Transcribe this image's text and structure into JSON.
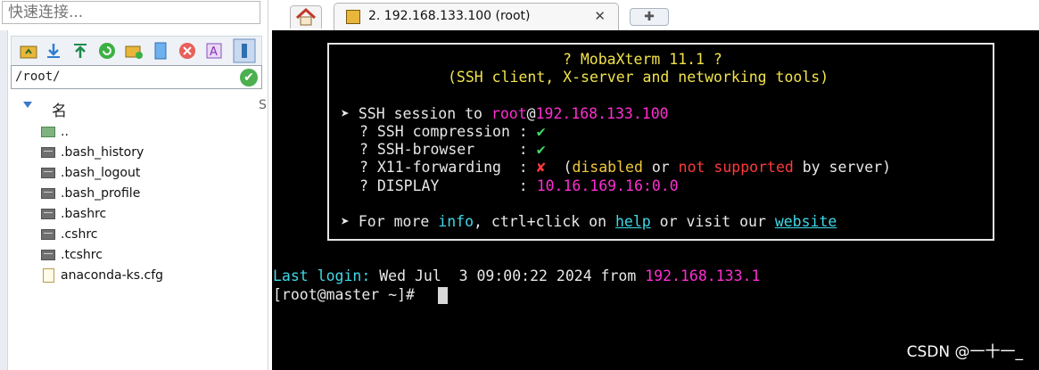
{
  "quick_connect": {
    "placeholder": "快速连接..."
  },
  "path": {
    "value": "/root/"
  },
  "file_list": {
    "header_name": "名",
    "header_sep": "S",
    "items": [
      {
        "name": "..",
        "icon": "folder-up-icon"
      },
      {
        "name": ".bash_history",
        "icon": "file-icon"
      },
      {
        "name": ".bash_logout",
        "icon": "file-icon"
      },
      {
        "name": ".bash_profile",
        "icon": "file-icon"
      },
      {
        "name": ".bashrc",
        "icon": "file-icon"
      },
      {
        "name": ".cshrc",
        "icon": "file-icon"
      },
      {
        "name": ".tcshrc",
        "icon": "file-icon"
      },
      {
        "name": "anaconda-ks.cfg",
        "icon": "document-icon"
      }
    ]
  },
  "tabs": {
    "active": {
      "title": "2. 192.168.133.100 (root)",
      "close": "✕"
    },
    "new_tab_symbol": "✚"
  },
  "terminal": {
    "banner_line1": "? MobaXterm 11.1 ?",
    "banner_line2": "(SSH client, X-server and networking tools)",
    "ssh_prefix": "➤ SSH session to ",
    "ssh_user": "root",
    "ssh_at": "@",
    "ssh_host": "192.168.133.100",
    "opt1_label": "? SSH compression : ",
    "opt1_val": "✔",
    "opt2_label": "? SSH-browser     : ",
    "opt2_val": "✔",
    "opt3_label": "? X11-forwarding  : ",
    "opt3_val": "✘",
    "opt3_paren_open": "(",
    "opt3_disabled": "disabled",
    "opt3_or": " or ",
    "opt3_notsup": "not supported",
    "opt3_byserver": " by server)",
    "opt4_label": "? DISPLAY         : ",
    "opt4_val": "10.16.169.16:0.0",
    "more_prefix": "➤ For more ",
    "more_info": "info",
    "more_mid": ", ctrl+click on ",
    "more_help": "help",
    "more_or": " or visit our ",
    "more_website": "website",
    "last_login_label": "Last login:",
    "last_login_text": " Wed Jul  3 09:00:22 2024 from ",
    "last_login_ip": "192.168.133.1",
    "prompt": "[root@master ~]# "
  },
  "watermark": "CSDN @一十一_"
}
